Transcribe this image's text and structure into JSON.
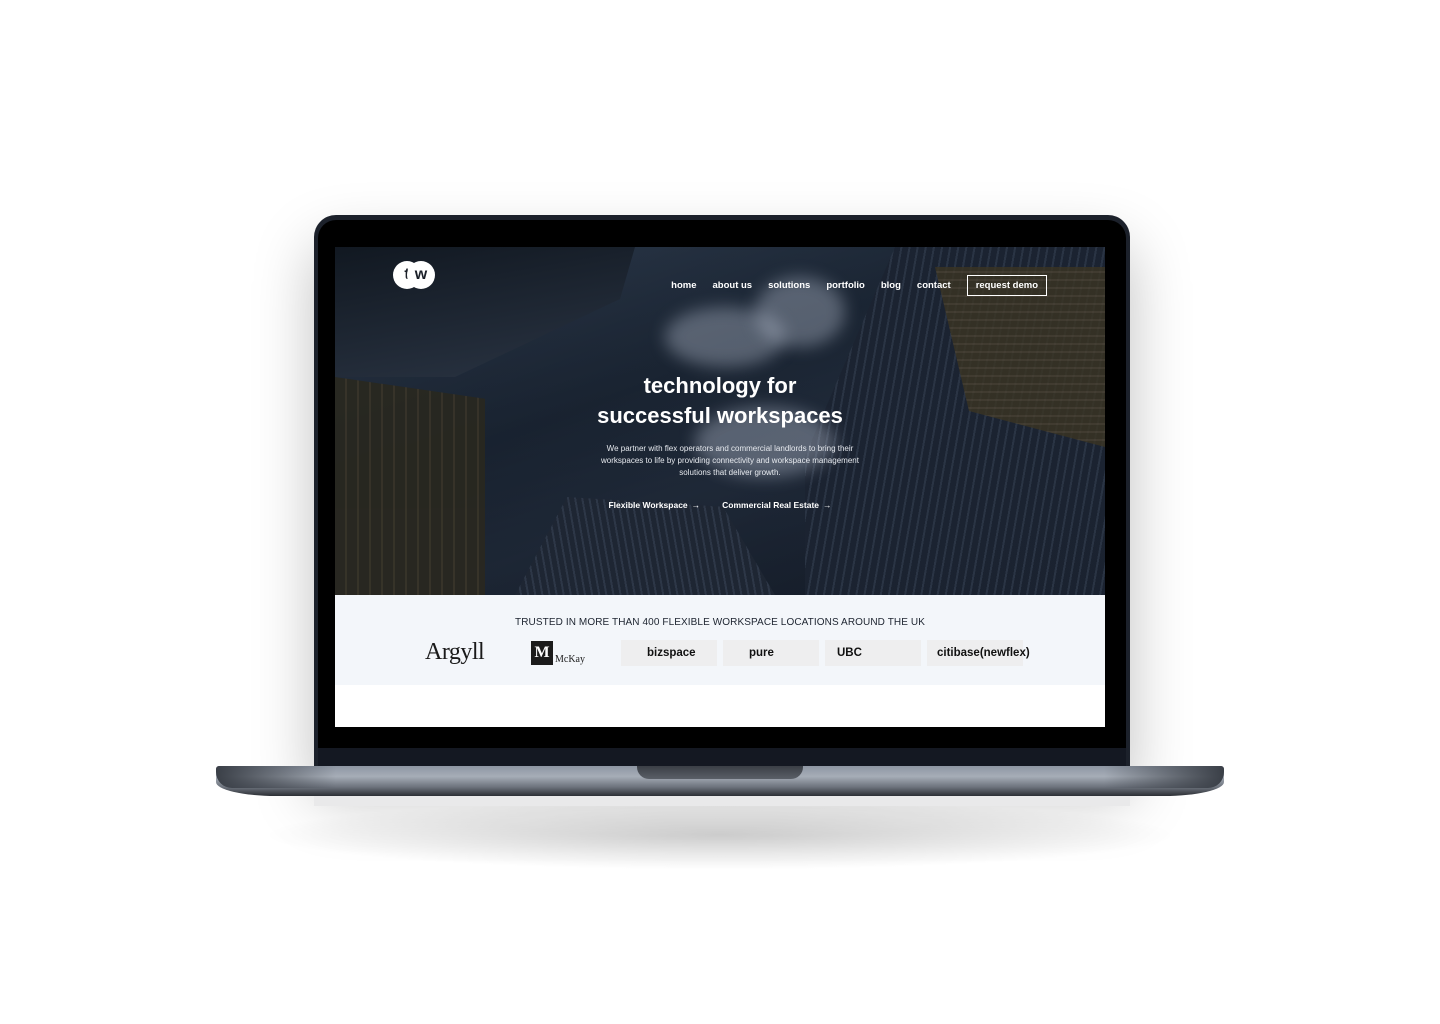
{
  "nav": {
    "logo_text": "t/w",
    "items": [
      "home",
      "about us",
      "solutions",
      "portfolio",
      "blog",
      "contact"
    ],
    "demo_label": "request demo"
  },
  "hero": {
    "title_line1": "technology for",
    "title_line2": "successful workspaces",
    "subtitle": "We partner with flex operators and commercial landlords to bring their workspaces to life by providing connectivity and workspace management solutions that deliver growth.",
    "cta1": "Flexible Workspace",
    "cta2": "Commercial Real Estate"
  },
  "trusted": {
    "title": "TRUSTED IN MORE THAN 400 FLEXIBLE WORKSPACE LOCATIONS AROUND THE UK",
    "logos": {
      "argyll": "Argyll",
      "mckay_mark": "M",
      "mckay_text": "McKay",
      "bizspace": "bizspace",
      "pure": "pure",
      "ubc": "UBC",
      "citibase": "citibase(newflex)"
    }
  },
  "colors": {
    "hero_overlay": "#1f2a38",
    "band": "#f3f6fa",
    "device": "#1c212b"
  }
}
